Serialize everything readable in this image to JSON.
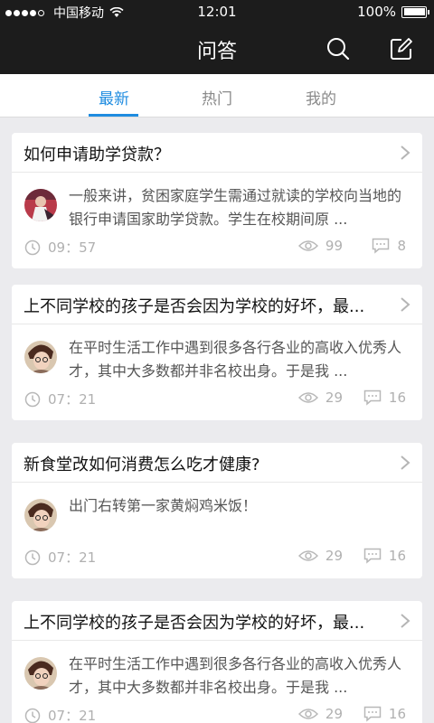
{
  "status_bar": {
    "carrier": "中国移动",
    "time": "12:01",
    "battery": "100%",
    "battery_level": 1.0
  },
  "nav": {
    "title": "问答",
    "icons": [
      "search-icon",
      "edit-icon"
    ]
  },
  "tabs": [
    {
      "label": "最新",
      "active": true
    },
    {
      "label": "热门",
      "active": false
    },
    {
      "label": "我的",
      "active": false
    }
  ],
  "colors": {
    "accent": "#1f8ce0",
    "header_bg": "#1c1c1c",
    "page_bg": "#ebebee"
  },
  "cards": [
    {
      "title": "如何申请助学贷款？",
      "answer": "一般来讲，贫困家庭学生需通过就读的学校向当地的银行申请国家助学贷款。学生在校期间原 ...",
      "time": "09：57",
      "views": "99",
      "comments": "8"
    },
    {
      "title": "上不同学校的孩子是否会因为学校的好坏，最...",
      "answer": "在平时生活工作中遇到很多各行各业的高收入优秀人才，其中大多数都并非名校出身。于是我 ...",
      "time": "07：21",
      "views": "29",
      "comments": "16"
    },
    {
      "title": "新食堂改如何消费怎么吃才健康?",
      "answer": "出门右转第一家黄焖鸡米饭！",
      "time": "07：21",
      "views": "29",
      "comments": "16"
    },
    {
      "title": "上不同学校的孩子是否会因为学校的好坏，最...",
      "answer": "在平时生活工作中遇到很多各行各业的高收入优秀人才，其中大多数都并非名校出身。于是我 ...",
      "time": "07：21",
      "views": "29",
      "comments": "16"
    }
  ]
}
